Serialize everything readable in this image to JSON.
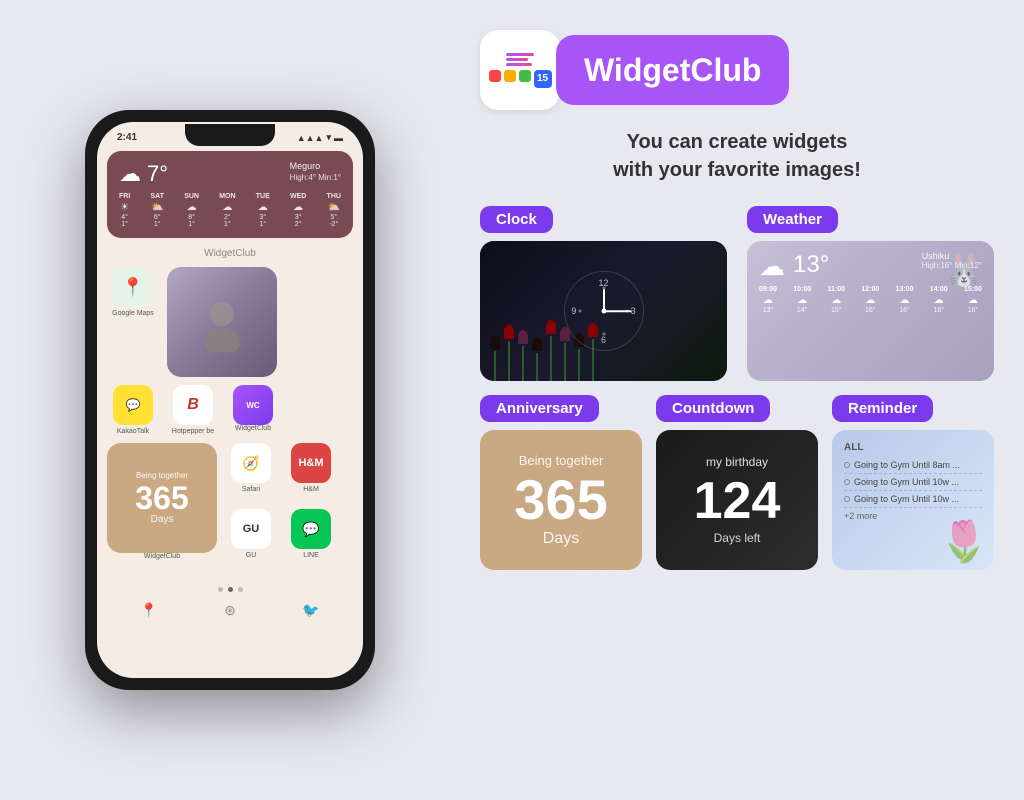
{
  "app": {
    "name": "WidgetClub",
    "tagline_line1": "You can create widgets",
    "tagline_line2": "with your favorite images!"
  },
  "phone": {
    "time": "2:41",
    "weather_widget": {
      "temp": "7°",
      "location": "Meguro",
      "high": "High:4°",
      "min": "Min:1°",
      "forecast": [
        {
          "day": "FRI",
          "temp": "4°/1°"
        },
        {
          "day": "SAT",
          "temp": "6°/1°"
        },
        {
          "day": "SUN",
          "temp": "8°/1°"
        },
        {
          "day": "MON",
          "temp": "2°/1°"
        },
        {
          "day": "TUE",
          "temp": "3°/1°"
        },
        {
          "day": "WED",
          "temp": "3°/2°"
        },
        {
          "day": "THU",
          "temp": "5°/-2°"
        }
      ]
    },
    "widgetclub_label": "WidgetClub",
    "apps": [
      {
        "label": "Google Maps",
        "icon": "📍"
      },
      {
        "label": "KakaoTalk",
        "icon": "💬"
      },
      {
        "label": "Hotpepper be",
        "icon": "B"
      },
      {
        "label": "WidgetClub",
        "icon": "WC"
      },
      {
        "label": "Safari",
        "icon": "🧭"
      },
      {
        "label": "H&M",
        "icon": "H&M"
      },
      {
        "label": "GU",
        "icon": "GU"
      },
      {
        "label": "LINE",
        "icon": "💬"
      }
    ],
    "anniversary": {
      "label": "Being together",
      "days": "365",
      "days_label": "Days"
    }
  },
  "widgets": {
    "clock": {
      "tag": "Clock",
      "hour": "12",
      "minute": "12"
    },
    "weather": {
      "tag": "Weather",
      "temp": "13°",
      "location": "Ushiku",
      "high": "High:16°",
      "min": "Min:12°",
      "forecast": [
        {
          "time": "09:00",
          "icon": "☁",
          "temp": "13°"
        },
        {
          "time": "10:00",
          "icon": "☁",
          "temp": "14°"
        },
        {
          "time": "11:00",
          "icon": "☁",
          "temp": "15°"
        },
        {
          "time": "12:00",
          "icon": "☁",
          "temp": "16°"
        },
        {
          "time": "13:00",
          "icon": "☁",
          "temp": "16°"
        },
        {
          "time": "14:00",
          "icon": "☁",
          "temp": "16°"
        },
        {
          "time": "15:00",
          "icon": "☁",
          "temp": "16°"
        }
      ]
    },
    "anniversary": {
      "tag": "Anniversary",
      "label": "Being together",
      "days": "365",
      "days_text": "Days"
    },
    "countdown": {
      "tag": "Countdown",
      "label": "my birthday",
      "days": "124",
      "days_left": "Days left"
    },
    "reminder": {
      "tag": "Reminder",
      "all_label": "ALL",
      "items": [
        "Going to Gym Until 8am ...",
        "Going to Gym Until 10w ...",
        ""
      ],
      "more": "+2 more"
    }
  },
  "colors": {
    "purple": "#7c3aed",
    "light_purple": "#a855f7",
    "phone_weather_bg": "#7a4a52",
    "anniversary_bg": "#c9a882",
    "countdown_bg": "#1a1a1a"
  }
}
